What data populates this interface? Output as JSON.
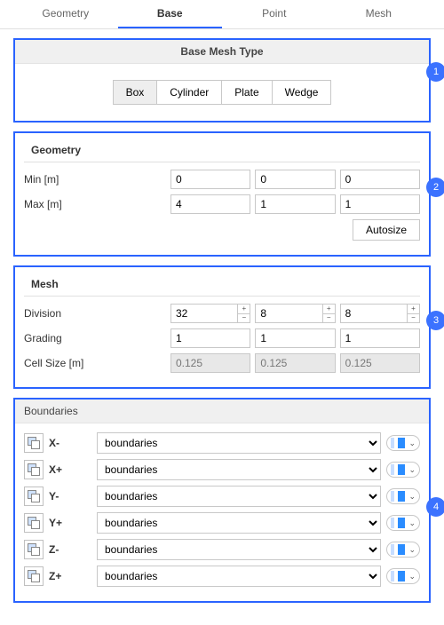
{
  "tabs": [
    "Geometry",
    "Base",
    "Point",
    "Mesh"
  ],
  "active_tab": "Base",
  "callouts": [
    "1",
    "2",
    "3",
    "4"
  ],
  "base_mesh": {
    "header": "Base Mesh Type",
    "options": [
      "Box",
      "Cylinder",
      "Plate",
      "Wedge"
    ],
    "active": "Box"
  },
  "geometry": {
    "title": "Geometry",
    "min_label": "Min [m]",
    "max_label": "Max [m]",
    "min": [
      "0",
      "0",
      "0"
    ],
    "max": [
      "4",
      "1",
      "1"
    ],
    "autosize_label": "Autosize"
  },
  "mesh": {
    "title": "Mesh",
    "division_label": "Division",
    "grading_label": "Grading",
    "cellsize_label": "Cell Size [m]",
    "division": [
      "32",
      "8",
      "8"
    ],
    "grading": [
      "1",
      "1",
      "1"
    ],
    "cell_size": [
      "0.125",
      "0.125",
      "0.125"
    ]
  },
  "boundaries": {
    "title": "Boundaries",
    "option_label": "boundaries",
    "items": [
      {
        "label": "X-"
      },
      {
        "label": "X+"
      },
      {
        "label": "Y-"
      },
      {
        "label": "Y+"
      },
      {
        "label": "Z-"
      },
      {
        "label": "Z+"
      }
    ]
  }
}
